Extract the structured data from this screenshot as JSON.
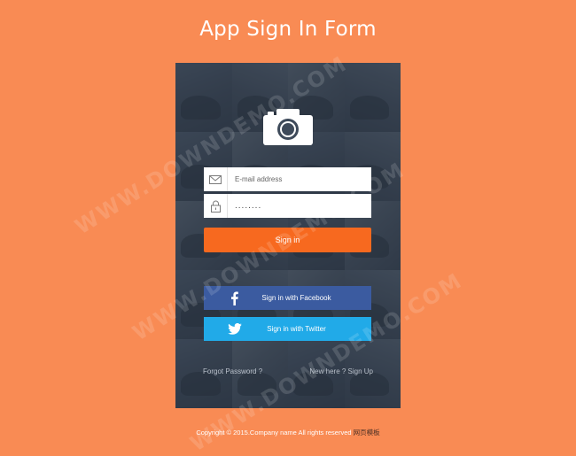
{
  "page": {
    "title": "App Sign In Form"
  },
  "form": {
    "email_placeholder": "E-mail address",
    "password_value": "........",
    "signin_label": "Sign in",
    "facebook_label": "Sign in with Facebook",
    "twitter_label": "Sign in with Twitter",
    "forgot_label": "Forgot Password ?",
    "signup_label": "New here ? Sign Up"
  },
  "icons": {
    "logo": "camera-icon",
    "email": "envelope-icon",
    "password": "lock-icon",
    "facebook": "facebook-icon",
    "twitter": "twitter-icon"
  },
  "watermark": {
    "text": "WWW.DOWNDEMO.COM"
  },
  "footer": {
    "copyright": "Copyright © 2015.Company name All rights reserved",
    "link_text": "网页模板"
  },
  "colors": {
    "background": "#f98b54",
    "signin": "#f7691f",
    "facebook": "#3b5ba0",
    "twitter": "#21aae8"
  }
}
